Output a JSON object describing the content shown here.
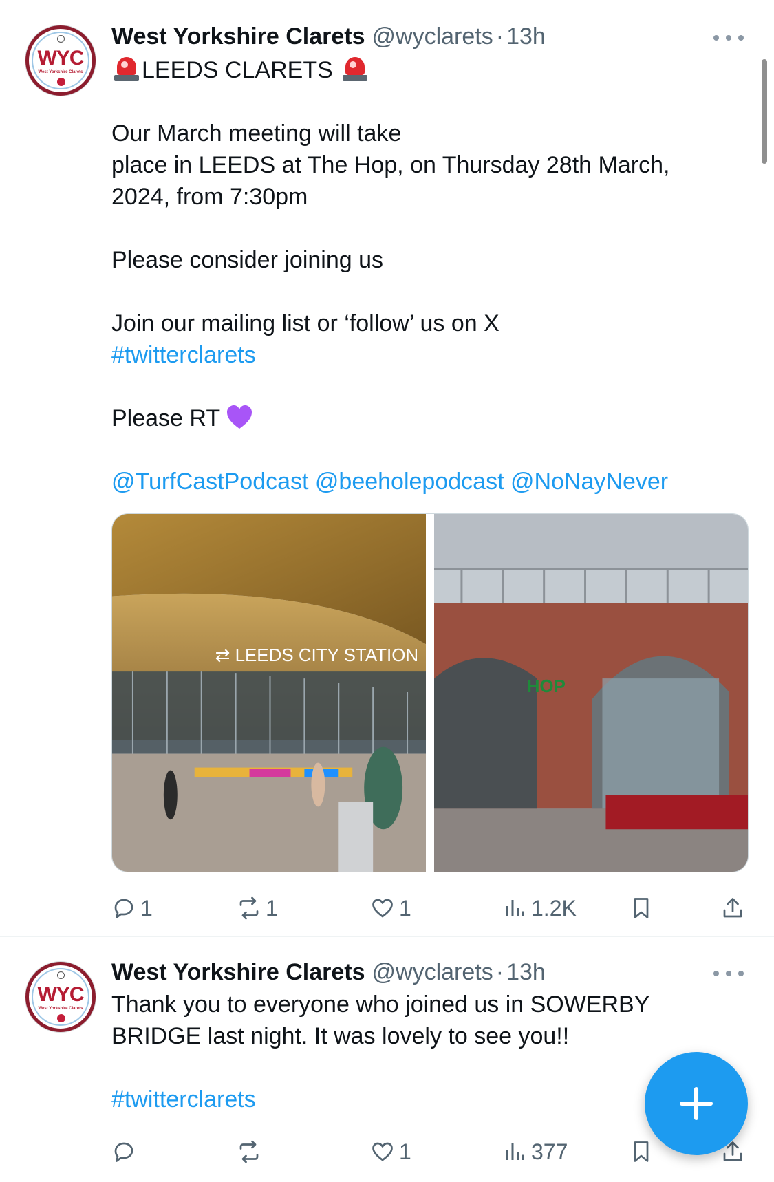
{
  "tweets": [
    {
      "author_name": "West Yorkshire Clarets",
      "handle": "@wyclarets",
      "separator": "·",
      "time": "13h",
      "avatar_text": "WYC",
      "avatar_sub": "West Yorkshire Clarets",
      "lines": {
        "l1": "LEEDS CLARETS",
        "l2": "Our March meeting will take",
        "l3": "place in LEEDS at The Hop, on Thursday 28th March,",
        "l4": "2024, from 7:30pm",
        "l5": "Please consider joining us",
        "l6": "Join our mailing list or ‘follow’ us on X",
        "hashtag": "#twitterclarets",
        "l7": "Please RT",
        "mentions": "@TurfCastPodcast @beeholepodcast @NoNayNever"
      },
      "images": {
        "left_sign": "⇄ LEEDS CITY STATION",
        "right_sign": "HOP"
      },
      "stats": {
        "replies": "1",
        "reposts": "1",
        "likes": "1",
        "views": "1.2K"
      }
    },
    {
      "author_name": "West Yorkshire Clarets",
      "handle": "@wyclarets",
      "separator": "·",
      "time": "13h",
      "avatar_text": "WYC",
      "avatar_sub": "West Yorkshire Clarets",
      "lines": {
        "l1": "Thank you to everyone who joined us in SOWERBY",
        "l2": "BRIDGE last night. It was lovely to see you!!",
        "hashtag": "#twitterclarets"
      },
      "stats": {
        "replies": "",
        "reposts": "",
        "likes": "1",
        "views": "377"
      }
    }
  ],
  "icons": {
    "reply": "reply-icon",
    "repost": "repost-icon",
    "like": "heart-icon",
    "views": "views-icon",
    "bookmark": "bookmark-icon",
    "share": "share-icon",
    "compose": "plus-icon",
    "more": "more-icon"
  },
  "colors": {
    "link": "#1d9bf0",
    "secondary_text": "#536471",
    "fab": "#1d9bf0",
    "claret": "#8c1d2e"
  }
}
